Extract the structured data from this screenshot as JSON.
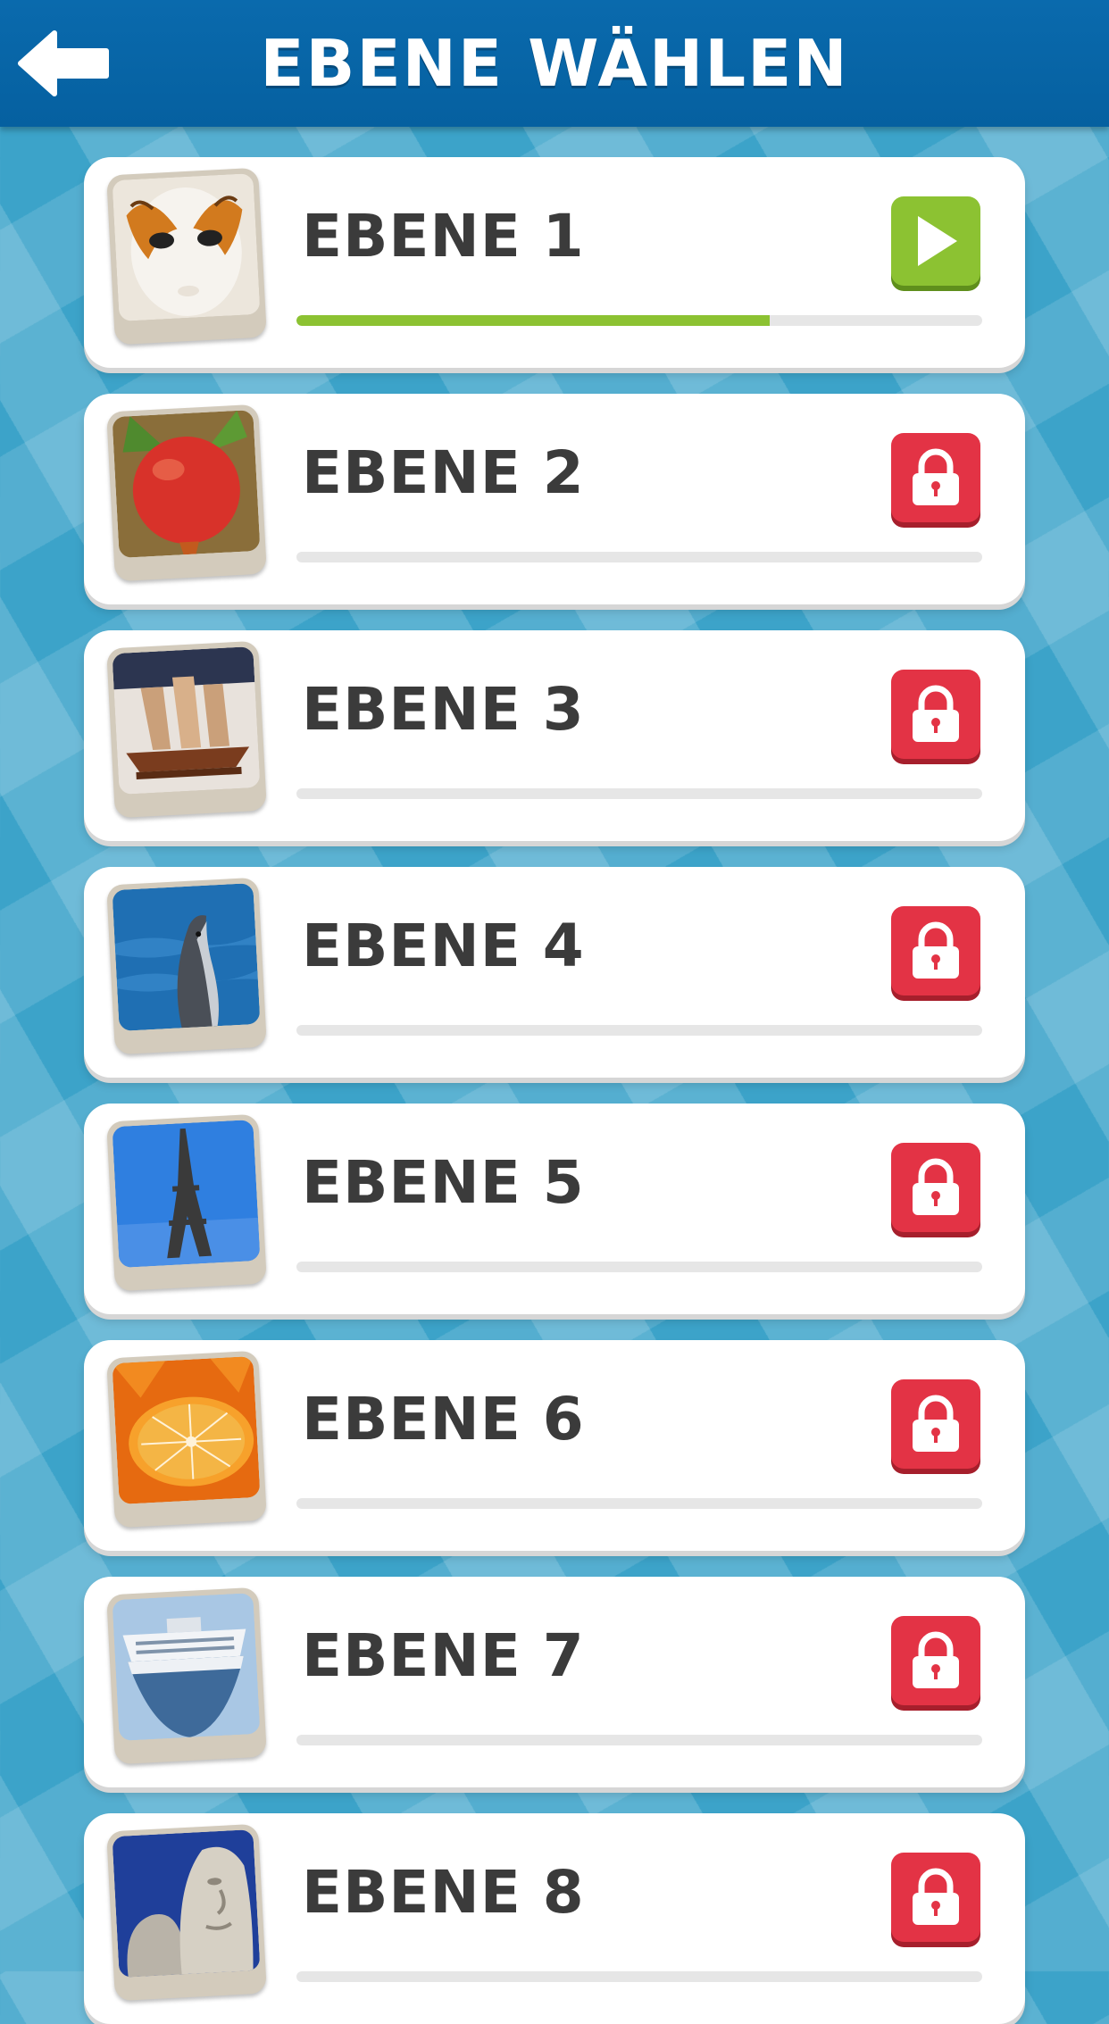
{
  "header": {
    "title": "EBENE WÄHLEN",
    "back_icon": "arrow-left-icon"
  },
  "colors": {
    "header": "#0a6aad",
    "progress": "#8cc232",
    "play": "#8cc232",
    "lock": "#e33345"
  },
  "levels": [
    {
      "label": "EBENE 1",
      "thumbnail": "venetian-mask",
      "status": "play",
      "progress": 0.69
    },
    {
      "label": "EBENE 2",
      "thumbnail": "pomegranate",
      "status": "locked",
      "progress": 0
    },
    {
      "label": "EBENE 3",
      "thumbnail": "sailing-ship-model",
      "status": "locked",
      "progress": 0
    },
    {
      "label": "EBENE 4",
      "thumbnail": "dolphin",
      "status": "locked",
      "progress": 0
    },
    {
      "label": "EBENE 5",
      "thumbnail": "eiffel-tower",
      "status": "locked",
      "progress": 0
    },
    {
      "label": "EBENE 6",
      "thumbnail": "oranges",
      "status": "locked",
      "progress": 0
    },
    {
      "label": "EBENE 7",
      "thumbnail": "cruise-ship",
      "status": "locked",
      "progress": 0
    },
    {
      "label": "EBENE 8",
      "thumbnail": "stone-sculpture",
      "status": "locked",
      "progress": 0
    }
  ]
}
